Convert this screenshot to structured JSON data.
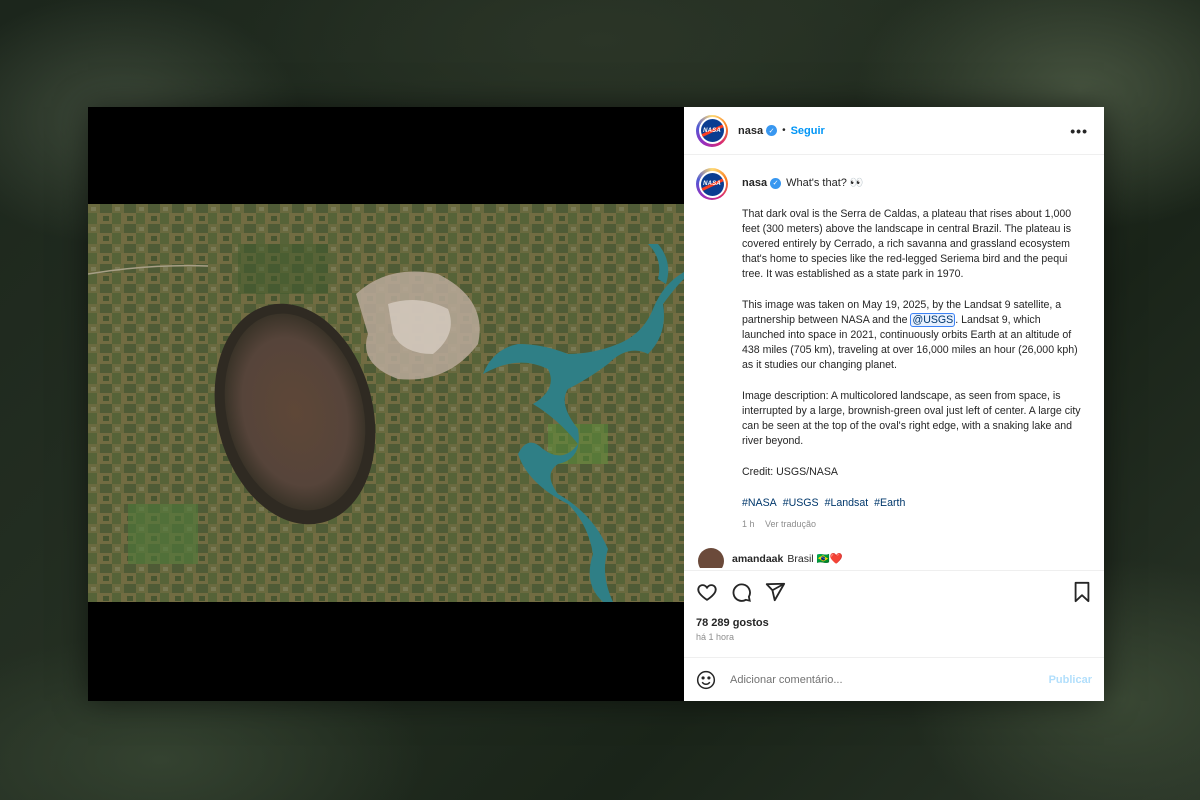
{
  "post": {
    "username": "nasa",
    "avatar_text": "NASA",
    "verified_icon": "✓",
    "follow_label": "Seguir",
    "more_label": "•••",
    "caption_title": "What's that? 👀",
    "caption_paragraphs": [
      "That dark oval is the Serra de Caldas, a plateau that rises about 1,000 feet (300 meters) above the landscape in central Brazil. The plateau is covered entirely by Cerrado, a rich savanna and grassland ecosystem that's home to species like the red-legged Seriema bird and the pequi tree. It was established as a state park in 1970."
    ],
    "para2_before": "This image was taken on May 19, 2025, by the Landsat 9 satellite, a partnership between NASA and the ",
    "para2_mention": "@USGS",
    "para2_after": ". Landsat 9, which launched into space in 2021, continuously orbits Earth at an altitude of 438 miles (705 km), traveling at over 16,000 miles an hour (26,000 kph) as it studies our changing planet.",
    "para3": "Image description: A multicolored landscape, as seen from space, is interrupted by a large, brownish-green oval just left of center. A large city can be seen at the top of the oval's right edge, with a snaking lake and river beyond.",
    "credit": "Credit: USGS/NASA",
    "hashtags": [
      "#NASA",
      "#USGS",
      "#Landsat",
      "#Earth"
    ],
    "caption_time": "1 h",
    "translate_label": "Ver tradução",
    "comment": {
      "username": "amandaak",
      "text": "Brasil 🇧🇷❤️"
    },
    "likes_text": "78 289 gostos",
    "posted_ago": "há 1 hora",
    "add_comment_placeholder": "Adicionar comentário...",
    "publish_label": "Publicar"
  },
  "colors": {
    "accent": "#0095f6",
    "text": "#262626",
    "muted": "#8e8e8e",
    "link": "#00376b"
  },
  "icons": [
    "heart-icon",
    "comment-icon",
    "share-icon",
    "bookmark-icon",
    "emoji-icon",
    "verified-icon"
  ]
}
